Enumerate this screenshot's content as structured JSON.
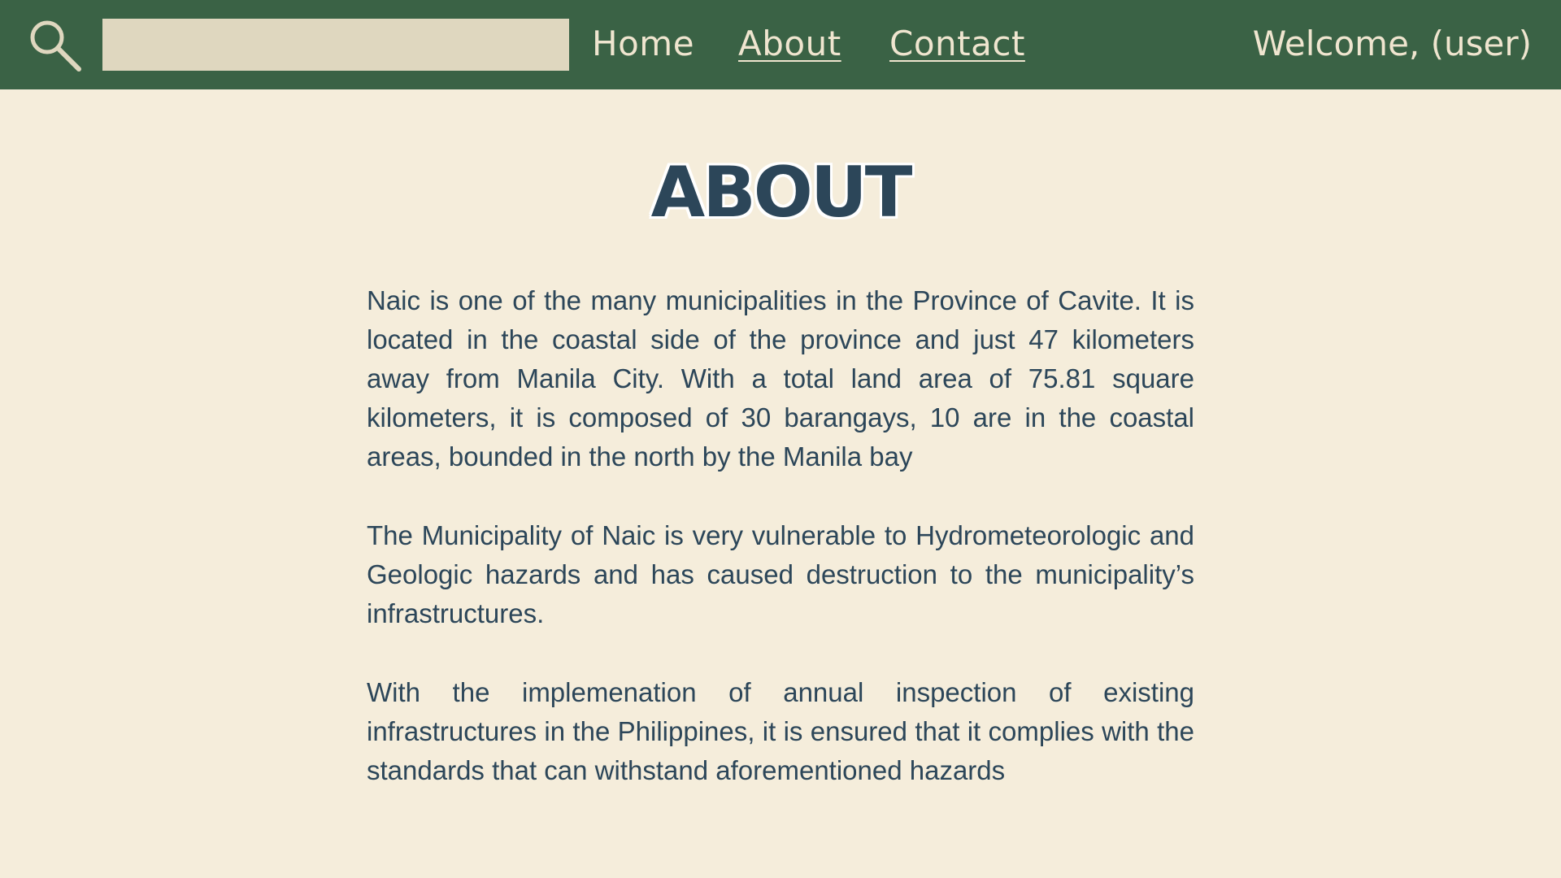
{
  "navbar": {
    "search": {
      "icon": "search-icon",
      "value": "",
      "placeholder": ""
    },
    "links": {
      "home": "Home",
      "about": "About",
      "contact": "Contact"
    },
    "welcome": "Welcome, (user)"
  },
  "main": {
    "title": "ABOUT",
    "paragraphs": [
      "Naic is one of the many municipalities in the Province of Cavite. It is located in the coastal side of the province and just 47 kilometers away from Manila City. With a total land area of 75.81 square kilometers, it is composed of 30 barangays, 10 are in the coastal areas, bounded in the north by the Manila bay",
      "The Municipality of Naic is very vulnerable to Hydrometeorologic and Geologic hazards and has caused destruction to the municipality’s infrastructures.",
      "With the implemenation of annual inspection of existing infrastructures in the Philippines, it is ensured that it complies with the standards that can withstand aforementioned hazards"
    ]
  },
  "colors": {
    "navbar_bg": "#3a6245",
    "page_bg": "#f5eddb",
    "search_bg": "#dfd7bf",
    "nav_text": "#efe5cf",
    "body_text": "#2c4659"
  }
}
